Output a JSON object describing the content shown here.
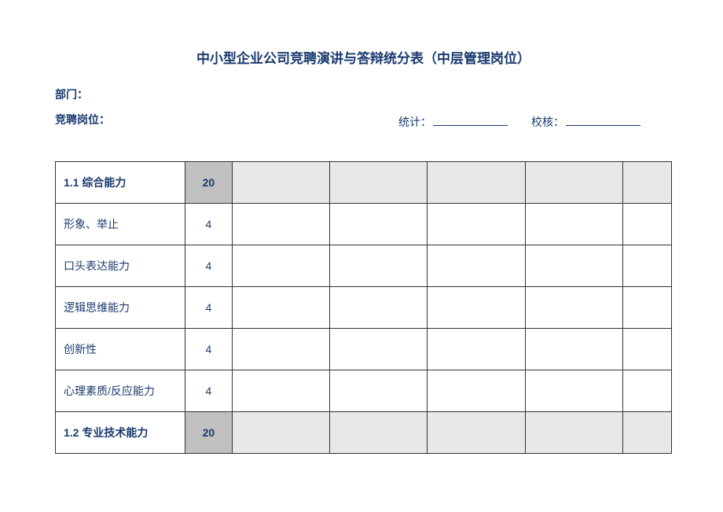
{
  "title": "中小型企业公司竞聘演讲与答辩统分表（中层管理岗位）",
  "fields": {
    "department": "部门：",
    "position": "竞聘岗位："
  },
  "signatures": {
    "stat_label": "统计：",
    "check_label": "校核："
  },
  "rows": [
    {
      "label": "1.1 综合能力",
      "score": "20",
      "header": true
    },
    {
      "label": "形象、举止",
      "score": "4",
      "header": false
    },
    {
      "label": "口头表达能力",
      "score": "4",
      "header": false
    },
    {
      "label": "逻辑思维能力",
      "score": "4",
      "header": false
    },
    {
      "label": "创新性",
      "score": "4",
      "header": false
    },
    {
      "label": "心理素质/反应能力",
      "score": "4",
      "header": false
    },
    {
      "label": "1.2 专业技术能力",
      "score": "20",
      "header": true
    }
  ]
}
